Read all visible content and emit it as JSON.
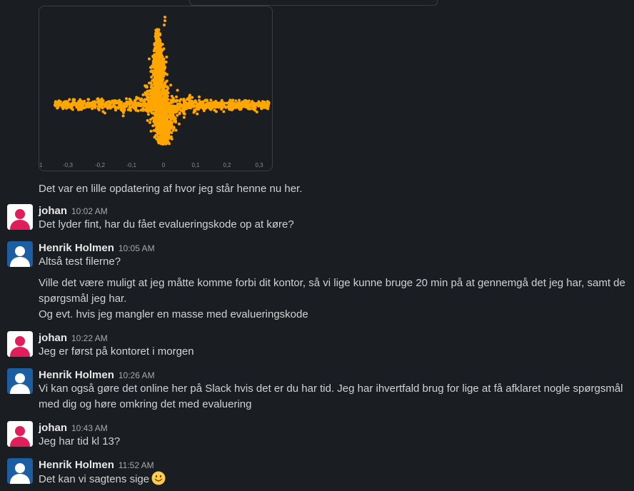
{
  "attachment": {
    "x_ticks": [
      "0,3",
      "0,2",
      "0,1",
      "0",
      "0,1",
      "0,2",
      "0,3"
    ],
    "x_ticks_signs": [
      "-",
      "-",
      "-",
      "",
      "",
      "",
      ""
    ],
    "point_color": "#ffa600",
    "leading_tick": "1"
  },
  "caption": "Det var en lille opdatering af hvor jeg står henne nu her.",
  "messages": [
    {
      "author": "johan",
      "time": "10:02 AM",
      "lines": [
        "Det lyder fint, har du fået evalueringskode op at køre?"
      ]
    },
    {
      "author": "Henrik Holmen",
      "time": "10:05 AM",
      "lines": [
        "Altså test filerne?"
      ]
    },
    {
      "author": "johan",
      "time": "10:22 AM",
      "lines": [
        "Jeg er først på kontoret i morgen"
      ]
    },
    {
      "author": "Henrik Holmen",
      "time": "10:26 AM",
      "lines": [
        "Vi kan også gøre det online her på Slack hvis det er du har tid. Jeg har ihvertfald brug for lige at få afklaret nogle spørgsmål",
        "med dig og høre omkring det med evaluering"
      ]
    },
    {
      "author": "johan",
      "time": "10:43 AM",
      "lines": [
        "Jeg har tid kl 13?"
      ]
    },
    {
      "author": "Henrik Holmen",
      "time": "11:52 AM",
      "lines": [
        "Det kan vi sagtens sige"
      ]
    }
  ],
  "continuation": {
    "lines": [
      "Ville det være muligt at jeg måtte komme forbi dit kontor, så vi lige kunne bruge 20 min på at gennemgå det jeg har, samt de",
      "spørgsmål jeg har.",
      "Og evt. hvis jeg mangler en masse med evalueringskode"
    ]
  },
  "colors": {
    "johan_avatar_accent": "#e01e5a",
    "henrik_avatar_bg": "#1d5ea3"
  },
  "icons": {
    "emoji": "slightly-smiling-face-icon"
  }
}
